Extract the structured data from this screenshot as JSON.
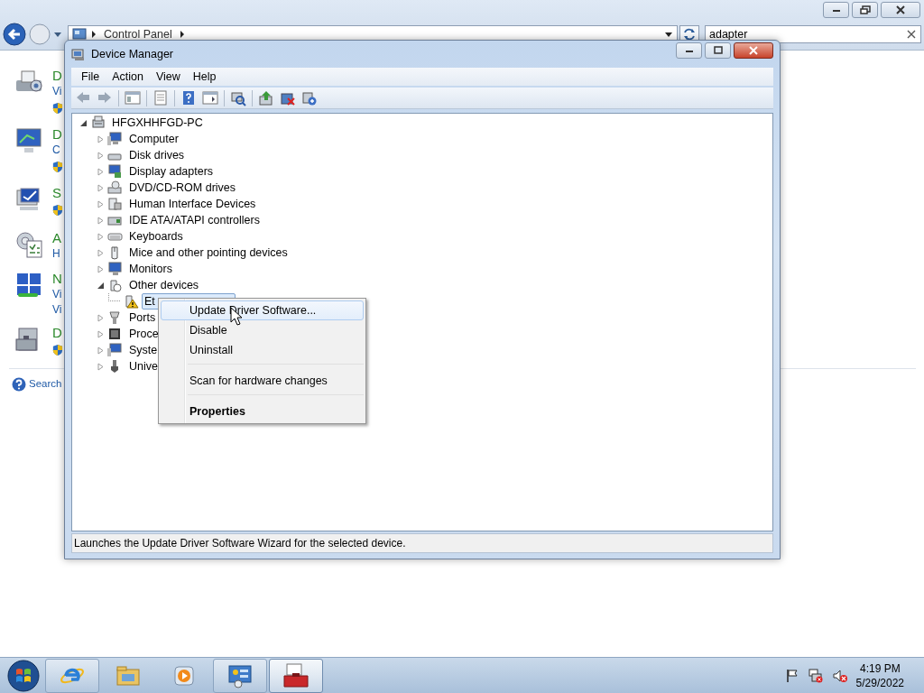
{
  "explorer": {
    "address": {
      "crumbs": [
        "Control Panel"
      ]
    },
    "search": {
      "value": "adapter"
    },
    "items": [
      {
        "title": "D",
        "lines": [
          "Vi"
        ],
        "shield": true
      },
      {
        "title": "D",
        "lines": [
          "C"
        ],
        "shield": true
      },
      {
        "title": "S",
        "shield": true
      },
      {
        "title": "A",
        "lines": [
          "H"
        ],
        "shield": false
      },
      {
        "title": "N",
        "lines": [
          "Vi",
          "Vi"
        ],
        "shield": false
      },
      {
        "title": "D",
        "shield": true
      }
    ],
    "help_link": "Search"
  },
  "device_manager": {
    "title": "Device Manager",
    "menu": [
      "File",
      "Action",
      "View",
      "Help"
    ],
    "tree": {
      "label": "HFGXHHFGD-PC",
      "expanded": true,
      "selected": false,
      "warning": false,
      "children": [
        {
          "label": "Computer",
          "expanded": false,
          "selected": false,
          "warning": false
        },
        {
          "label": "Disk drives",
          "expanded": false,
          "selected": false,
          "warning": false
        },
        {
          "label": "Display adapters",
          "expanded": false,
          "selected": false,
          "warning": false
        },
        {
          "label": "DVD/CD-ROM drives",
          "expanded": false,
          "selected": false,
          "warning": false
        },
        {
          "label": "Human Interface Devices",
          "expanded": false,
          "selected": false,
          "warning": false
        },
        {
          "label": "IDE ATA/ATAPI controllers",
          "expanded": false,
          "selected": false,
          "warning": false
        },
        {
          "label": "Keyboards",
          "expanded": false,
          "selected": false,
          "warning": false
        },
        {
          "label": "Mice and other pointing devices",
          "expanded": false,
          "selected": false,
          "warning": false
        },
        {
          "label": "Monitors",
          "expanded": false,
          "selected": false,
          "warning": false
        },
        {
          "label": "Other devices",
          "expanded": true,
          "selected": false,
          "warning": false,
          "children": [
            {
              "label": "Et",
              "selected": true,
              "warning": true
            }
          ]
        },
        {
          "label": "Ports",
          "expanded": false,
          "selected": false,
          "warning": false
        },
        {
          "label": "Proce",
          "expanded": false,
          "selected": false,
          "warning": false
        },
        {
          "label": "Syste",
          "expanded": false,
          "selected": false,
          "warning": false
        },
        {
          "label": "Unive",
          "expanded": false,
          "selected": false,
          "warning": false
        }
      ]
    },
    "status_bar": "Launches the Update Driver Software Wizard for the selected device."
  },
  "context_menu": {
    "items": [
      {
        "kind": "item",
        "label": "Update Driver Software...",
        "selected": true,
        "default": false
      },
      {
        "kind": "item",
        "label": "Disable",
        "selected": false,
        "default": false
      },
      {
        "kind": "item",
        "label": "Uninstall",
        "selected": false,
        "default": false
      },
      {
        "kind": "separator"
      },
      {
        "kind": "item",
        "label": "Scan for hardware changes",
        "selected": false,
        "default": false
      },
      {
        "kind": "separator"
      },
      {
        "kind": "item",
        "label": "Properties",
        "selected": false,
        "default": true
      }
    ]
  },
  "taskbar": {
    "buttons": [
      {
        "running": true,
        "selected": false
      },
      {
        "running": false,
        "selected": false
      },
      {
        "running": false,
        "selected": false
      },
      {
        "running": true,
        "selected": false
      },
      {
        "running": true,
        "selected": true
      }
    ],
    "clock": {
      "time": "4:19 PM",
      "date": "5/29/2022"
    }
  }
}
